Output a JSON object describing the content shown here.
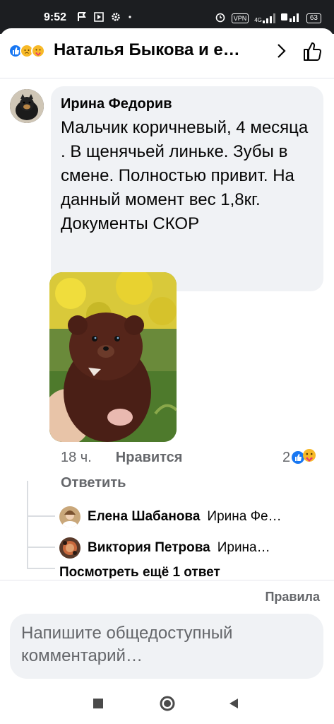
{
  "status_bar": {
    "time": "9:52",
    "vpn": "VPN",
    "battery": "63",
    "net_4g": "4G"
  },
  "header": {
    "reactions": [
      "like",
      "sad",
      "care"
    ],
    "title": "Наталья Быкова и е…"
  },
  "comment": {
    "author": "Ирина Федорив",
    "text": "Мальчик коричневый, 4 месяца . В щенячьей линьке. Зубы в смене. Полностью привит. На данный момент вес 1,8кг. Документы СКОР",
    "time": "18 ч.",
    "like_label": "Нравится",
    "reply_label": "Ответить",
    "reaction_count": "2"
  },
  "replies": [
    {
      "name": "Елена Шабанова",
      "snippet": "Ирина Фе…"
    },
    {
      "name": "Виктория Петрова",
      "snippet": "Ирина…"
    }
  ],
  "more_replies": "Посмотреть ещё 1 ответ",
  "rules_label": "Правила",
  "composer": {
    "placeholder": "Напишите общедоступный комментарий…"
  },
  "colors": {
    "accent": "#1877f2",
    "bubble": "#f0f2f5",
    "secondary_text": "#65676b"
  }
}
